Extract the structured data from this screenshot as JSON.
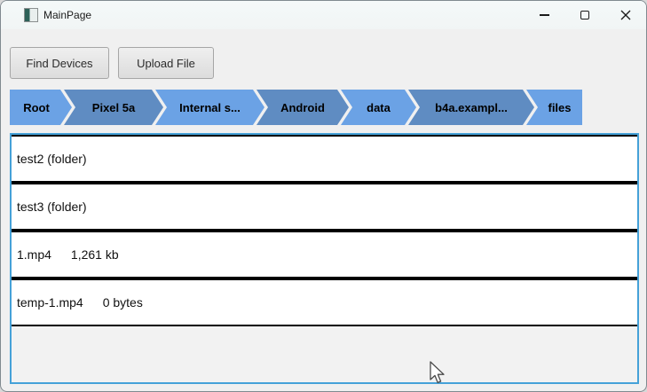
{
  "window": {
    "title": "MainPage",
    "icons": {
      "app": "app-icon",
      "minimize": "minimize-icon",
      "maximize": "maximize-icon",
      "close": "close-icon",
      "cursor": "arrow-cursor"
    }
  },
  "toolbar": {
    "buttons": [
      {
        "label": "Find Devices"
      },
      {
        "label": "Upload File"
      }
    ]
  },
  "breadcrumb": {
    "items": [
      {
        "label": "Root"
      },
      {
        "label": "Pixel 5a"
      },
      {
        "label": "Internal s..."
      },
      {
        "label": "Android"
      },
      {
        "label": "data"
      },
      {
        "label": "b4a.exampl..."
      },
      {
        "label": "files"
      }
    ],
    "light_color": "#6ba2e5",
    "dark_color": "#5f8cc2"
  },
  "file_list": {
    "items": [
      {
        "name": "test2 (folder)",
        "size": ""
      },
      {
        "name": "test3 (folder)",
        "size": ""
      },
      {
        "name": "1.mp4",
        "size": "1,261 kb"
      },
      {
        "name": "temp-1.mp4",
        "size": "0 bytes"
      }
    ]
  },
  "colors": {
    "list_border": "#45a1d8",
    "titlebar_bg": "#f4f9f9",
    "content_bg": "#f0f0f0"
  }
}
